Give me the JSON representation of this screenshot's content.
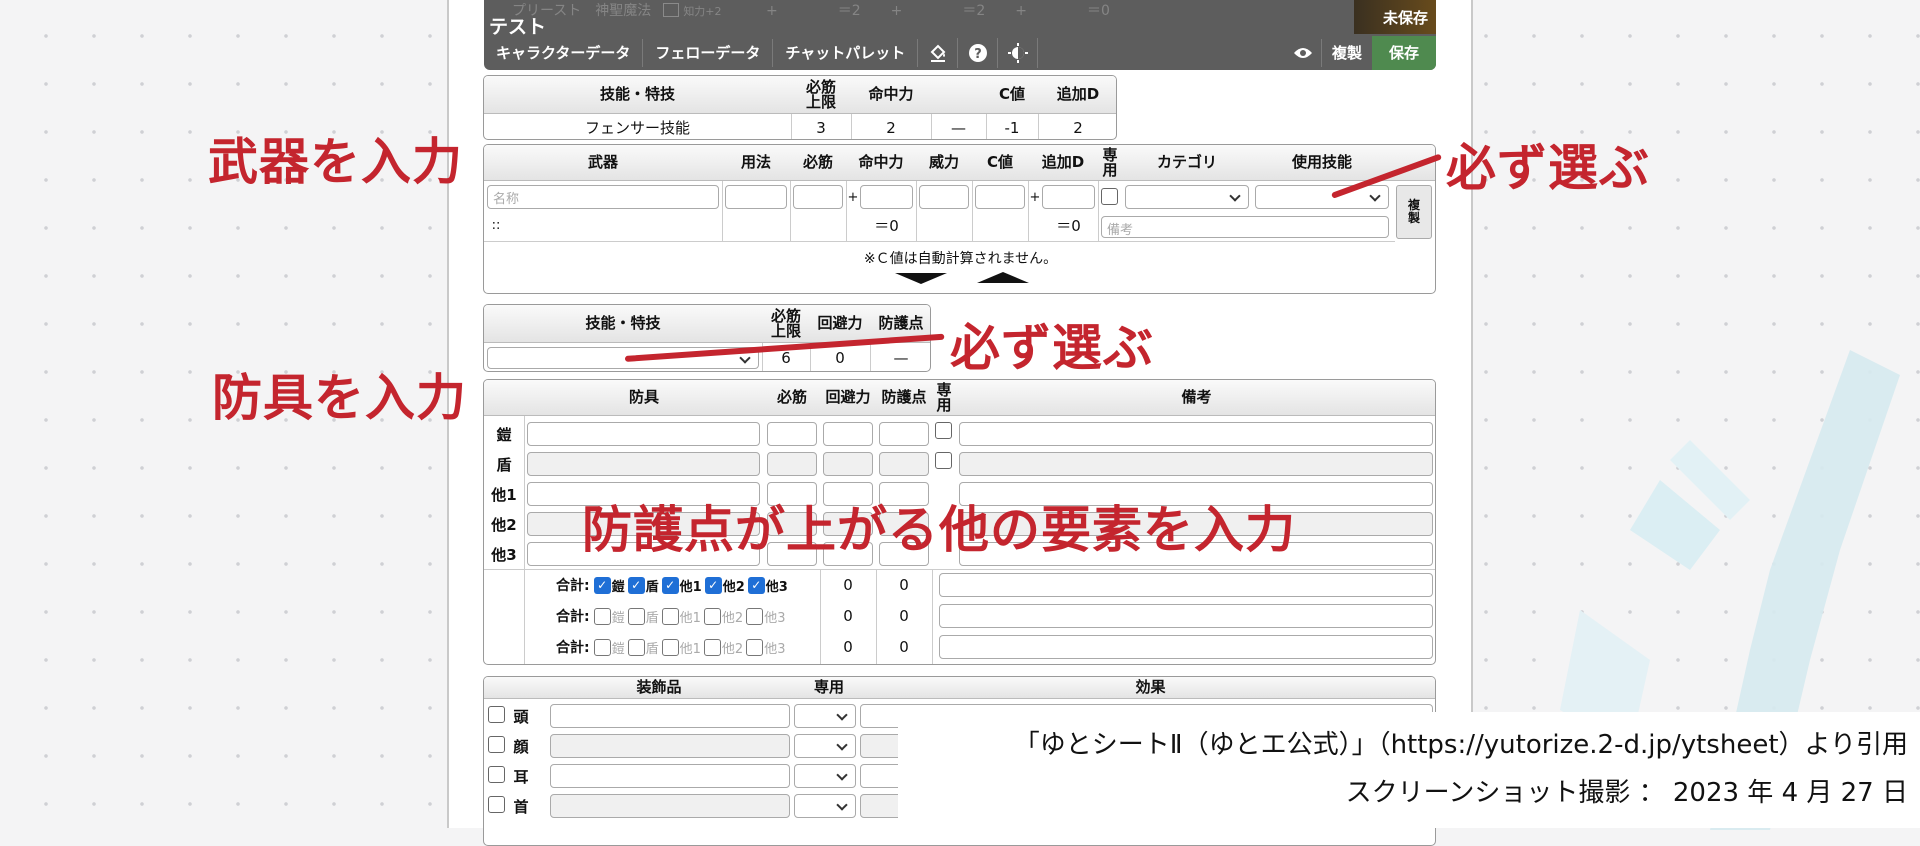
{
  "header": {
    "ghost": "プリースト　神聖魔法",
    "ghost_mod": "知力+2",
    "ghost_vals": [
      "+",
      "＝2",
      "+",
      "＝2",
      "+",
      "＝0"
    ],
    "title": "テスト",
    "unsaved": "未保存",
    "menu": [
      "キャラクターデータ",
      "フェローデータ",
      "チャットパレット"
    ],
    "icons": [
      "paint-bucket-icon",
      "help-icon",
      "theme-toggle-icon"
    ],
    "view_icon": "eye-icon",
    "copy": "複製",
    "save": "保存"
  },
  "skill_table": {
    "headers": [
      "技能・特技",
      "必筋\n上限",
      "命中力",
      "",
      "C値",
      "追加D"
    ],
    "row": [
      "フェンサー技能",
      "3",
      "2",
      "—",
      "-1",
      "2"
    ]
  },
  "weapon_table": {
    "headers": [
      "武器",
      "用法",
      "必筋",
      "命中力",
      "威力",
      "C値",
      "追加D",
      "専\n用",
      "カテゴリ",
      "使用技能"
    ],
    "name_placeholder": "名称",
    "note_placeholder": "備考",
    "drag": "::",
    "plus": "+",
    "eq": [
      "＝0",
      "＝0"
    ],
    "dup": "複\n製",
    "note": "※Ｃ値は自動計算されません。",
    "add": "+",
    "remove": "−"
  },
  "armor_skill": {
    "headers": [
      "技能・特技",
      "必筋\n上限",
      "回避力",
      "防護点"
    ],
    "values": [
      "6",
      "0",
      "—"
    ]
  },
  "armor_table": {
    "headers": [
      "防具",
      "必筋",
      "回避力",
      "防護点",
      "専\n用",
      "備考"
    ],
    "rows": [
      "鎧",
      "盾",
      "他1",
      "他2",
      "他3"
    ],
    "totals": [
      {
        "label": "合計:",
        "checks": [
          {
            "t": "鎧",
            "on": true
          },
          {
            "t": "盾",
            "on": true
          },
          {
            "t": "他1",
            "on": true
          },
          {
            "t": "他2",
            "on": true
          },
          {
            "t": "他3",
            "on": true
          }
        ],
        "eva": "0",
        "def": "0"
      },
      {
        "label": "合計:",
        "checks": [
          {
            "t": "鎧",
            "on": false
          },
          {
            "t": "盾",
            "on": false
          },
          {
            "t": "他1",
            "on": false
          },
          {
            "t": "他2",
            "on": false
          },
          {
            "t": "他3",
            "on": false
          }
        ],
        "eva": "0",
        "def": "0"
      },
      {
        "label": "合計:",
        "checks": [
          {
            "t": "鎧",
            "on": false
          },
          {
            "t": "盾",
            "on": false
          },
          {
            "t": "他1",
            "on": false
          },
          {
            "t": "他2",
            "on": false
          },
          {
            "t": "他3",
            "on": false
          }
        ],
        "eva": "0",
        "def": "0"
      }
    ]
  },
  "accessory_table": {
    "headers": [
      "装飾品",
      "専用",
      "効果"
    ],
    "rows": [
      "頭",
      "顔",
      "耳",
      "首"
    ]
  },
  "annotations": {
    "weapon": "武器を入力",
    "armor": "防具を入力",
    "must1": "必ず選ぶ",
    "must2": "必ず選ぶ",
    "defense": "防護点が上がる他の要素を入力"
  },
  "citation": {
    "line1": "「ゆとシートⅡ（ゆとエ公式）」（https://yutorize.2-d.jp/ytsheet）より引用",
    "line2": "スクリーンショット撮影 ： 2023 年 4 月 27 日"
  },
  "colors": {
    "annotation_red": "#c4252e",
    "header_bg": "#5d5d5d",
    "save_green": "#4f8a4f",
    "check_blue": "#1f6fd6"
  }
}
